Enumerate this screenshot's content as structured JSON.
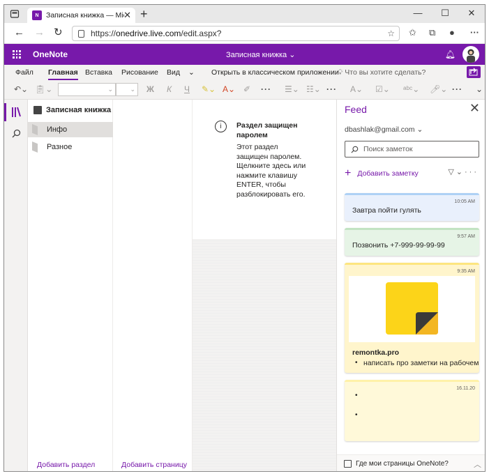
{
  "browser": {
    "tab_title": "Записная книжка — Microsoft OneNote Online",
    "favicon_text": "N",
    "url_prefix": "https://",
    "url_host": "onedrive.live.com",
    "url_path": "/edit.aspx?",
    "new_tab": "+",
    "close_tab": "✕"
  },
  "app": {
    "name": "OneNote",
    "notebook_title": "Записная книжка",
    "brand_color": "#7719aa"
  },
  "ribbon": {
    "tabs": [
      "Файл",
      "Главная",
      "Вставка",
      "Рисование",
      "Вид"
    ],
    "active_tab": "Главная",
    "open_desktop": "Открыть в классическом приложении",
    "tell_me": "Что вы хотите сделать?",
    "bold": "Ж",
    "italic": "К",
    "underline": "Ч"
  },
  "nav": {
    "notebook": "Записная книжка",
    "sections": [
      {
        "label": "Инфо",
        "selected": true
      },
      {
        "label": "Разное",
        "selected": false
      }
    ],
    "add_section": "Добавить раздел",
    "add_page": "Добавить страницу"
  },
  "content": {
    "title": "Раздел защищен паролем",
    "body": "Этот раздел защищен паролем. Щелкните здесь или нажмите клавишу ENTER, чтобы разблокировать его."
  },
  "feed": {
    "title": "Feed",
    "account": "dbashlak@gmail.com",
    "search_placeholder": "Поиск заметок",
    "add_note": "Добавить заметку",
    "notes": [
      {
        "time": "10:05 AM",
        "text": "Завтра пойти гулять",
        "color": "blue"
      },
      {
        "time": "9:57 AM",
        "text": "Позвонить +7-999-99-99-99",
        "color": "green"
      },
      {
        "time": "9:35 AM",
        "title": "remontka.pro",
        "bullet": "написать про заметки на рабочем",
        "color": "yellow"
      },
      {
        "time": "16.11.20",
        "color": "pale"
      }
    ],
    "footer": "Где мои страницы OneNote?"
  }
}
